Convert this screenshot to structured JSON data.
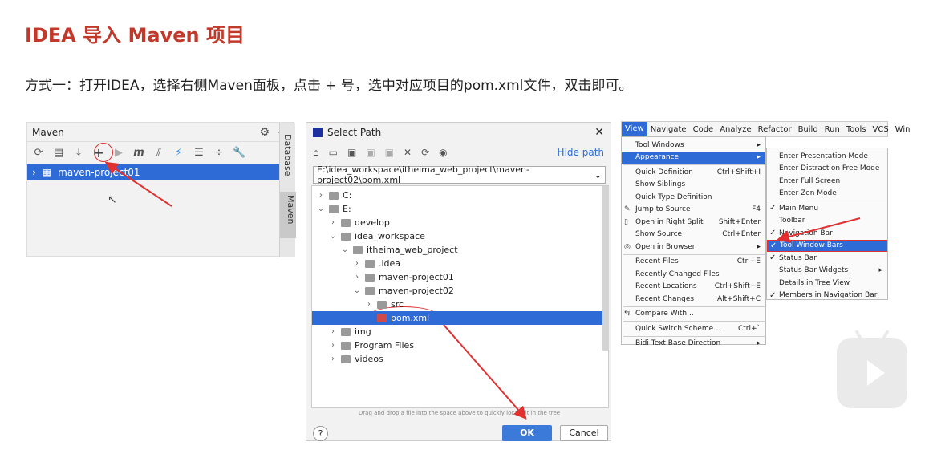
{
  "title": "IDEA 导入 Maven 项目",
  "subtitle": "方式一：打开IDEA，选择右侧Maven面板，点击 + 号，选中对应项目的pom.xml文件，双击即可。",
  "maven_panel": {
    "header": "Maven",
    "project": "maven-project01",
    "side_tabs": [
      "Database",
      "Maven"
    ]
  },
  "dialog": {
    "title": "Select Path",
    "hide_path": "Hide path",
    "path": "E:\\idea_workspace\\itheima_web_project\\maven-project02\\pom.xml",
    "tree": [
      {
        "label": "C:",
        "chev": "›",
        "indent": 0
      },
      {
        "label": "E:",
        "chev": "⌄",
        "indent": 0
      },
      {
        "label": "develop",
        "chev": "›",
        "indent": 1
      },
      {
        "label": "idea_workspace",
        "chev": "⌄",
        "indent": 1
      },
      {
        "label": "itheima_web_project",
        "chev": "⌄",
        "indent": 2
      },
      {
        "label": ".idea",
        "chev": "›",
        "indent": 3
      },
      {
        "label": "maven-project01",
        "chev": "›",
        "indent": 3
      },
      {
        "label": "maven-project02",
        "chev": "⌄",
        "indent": 3
      },
      {
        "label": "src",
        "chev": "›",
        "indent": 4
      },
      {
        "label": "pom.xml",
        "chev": "",
        "indent": 4,
        "selected": true
      },
      {
        "label": "img",
        "chev": "›",
        "indent": 1
      },
      {
        "label": "Program Files",
        "chev": "›",
        "indent": 1
      },
      {
        "label": "videos",
        "chev": "›",
        "indent": 1
      }
    ],
    "drag_hint": "Drag and drop a file into the space above to quickly locate it in the tree",
    "help": "?",
    "ok": "OK",
    "cancel": "Cancel"
  },
  "menubar": [
    "View",
    "Navigate",
    "Code",
    "Analyze",
    "Refactor",
    "Build",
    "Run",
    "Tools",
    "VCS",
    "Win"
  ],
  "view_menu": [
    {
      "label": "Tool Windows",
      "shortcut": "▸"
    },
    {
      "label": "Appearance",
      "shortcut": "▸",
      "active": true
    },
    {
      "sep": true
    },
    {
      "label": "Quick Definition",
      "shortcut": "Ctrl+Shift+I"
    },
    {
      "label": "Show Siblings",
      "shortcut": ""
    },
    {
      "label": "Quick Type Definition",
      "shortcut": ""
    },
    {
      "label": "Jump to Source",
      "shortcut": "F4",
      "icon": "✎"
    },
    {
      "label": "Open in Right Split",
      "shortcut": "Shift+Enter",
      "icon": "▯"
    },
    {
      "label": "Show Source",
      "shortcut": "Ctrl+Enter"
    },
    {
      "label": "Open in Browser",
      "shortcut": "▸",
      "icon": "◎"
    },
    {
      "sep": true
    },
    {
      "label": "Recent Files",
      "shortcut": "Ctrl+E"
    },
    {
      "label": "Recently Changed Files",
      "shortcut": ""
    },
    {
      "label": "Recent Locations",
      "shortcut": "Ctrl+Shift+E"
    },
    {
      "label": "Recent Changes",
      "shortcut": "Alt+Shift+C"
    },
    {
      "sep": true
    },
    {
      "label": "Compare With...",
      "shortcut": "",
      "icon": "⇆"
    },
    {
      "sep": true
    },
    {
      "label": "Quick Switch Scheme...",
      "shortcut": "Ctrl+`"
    },
    {
      "sep": true
    },
    {
      "label": "Bidi Text Base Direction",
      "shortcut": "▸"
    }
  ],
  "appearance_menu": [
    {
      "label": "Enter Presentation Mode"
    },
    {
      "label": "Enter Distraction Free Mode"
    },
    {
      "label": "Enter Full Screen"
    },
    {
      "label": "Enter Zen Mode"
    },
    {
      "sep": true
    },
    {
      "label": "Main Menu",
      "checked": true
    },
    {
      "label": "Toolbar"
    },
    {
      "label": "Navigation Bar",
      "checked": true
    },
    {
      "label": "Tool Window Bars",
      "checked": true,
      "active": true
    },
    {
      "label": "Status Bar",
      "checked": true
    },
    {
      "label": "Status Bar Widgets",
      "arrow": "▸"
    },
    {
      "label": "Details in Tree View"
    },
    {
      "label": "Members in Navigation Bar",
      "checked": true
    }
  ]
}
